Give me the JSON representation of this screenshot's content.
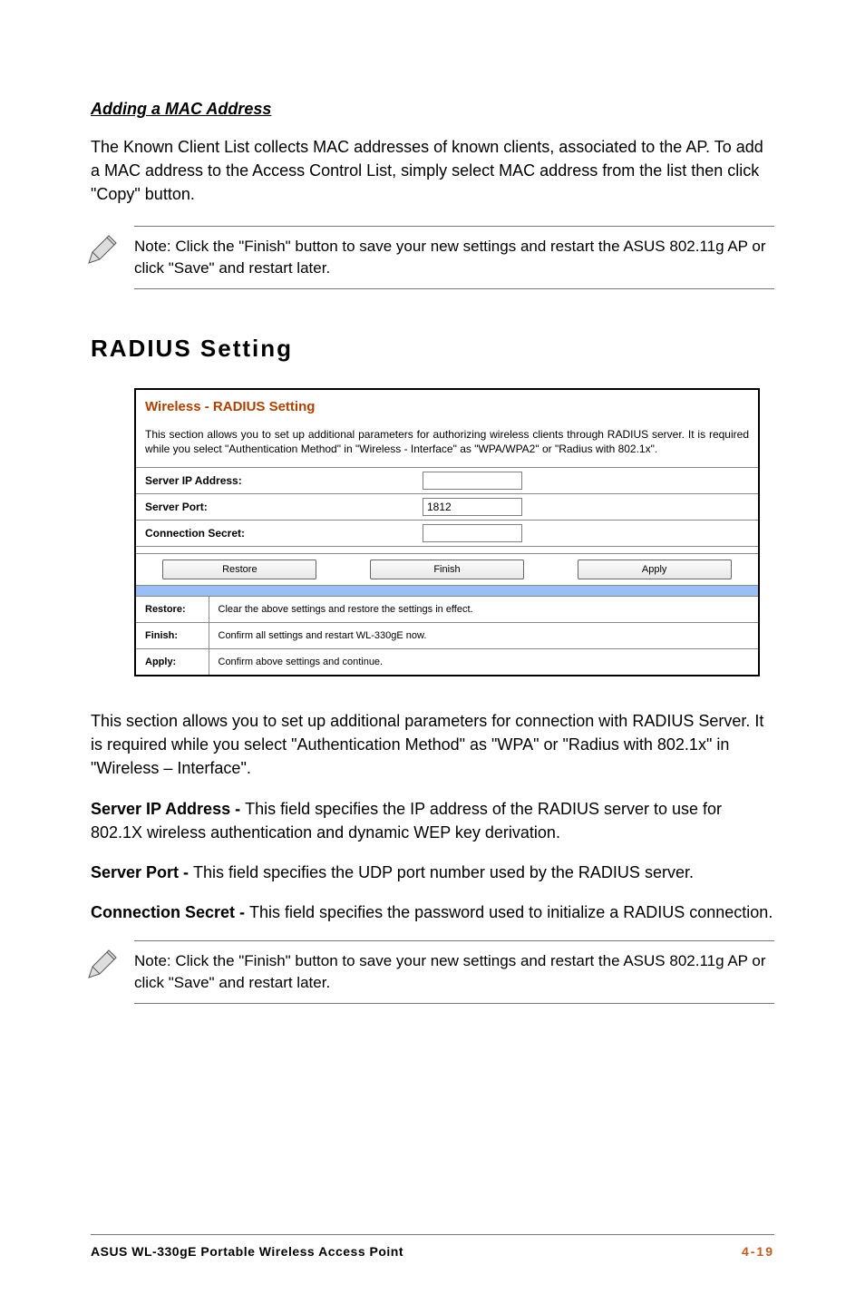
{
  "section1": {
    "heading": "Adding a MAC Address",
    "body": "The Known Client List collects MAC addresses of known clients, associated to the AP. To add a MAC address to the Access Control List, simply select MAC address from the list then click \"Copy\" button.",
    "note": "Note: Click the \"Finish\" button to save your new settings and restart the ASUS 802.11g AP or click \"Save\" and restart later."
  },
  "section2": {
    "heading": "RADIUS Setting",
    "panel": {
      "title": "Wireless - RADIUS Setting",
      "description": "This section allows you to set up additional parameters for authorizing wireless clients through RADIUS server. It is required while you select \"Authentication Method\" in \"Wireless - Interface\" as \"WPA/WPA2\" or \"Radius with 802.1x\".",
      "fields": {
        "server_ip_label": "Server IP Address:",
        "server_ip_value": "",
        "server_port_label": "Server Port:",
        "server_port_value": "1812",
        "conn_secret_label": "Connection Secret:",
        "conn_secret_value": ""
      },
      "buttons": {
        "restore": "Restore",
        "finish": "Finish",
        "apply": "Apply"
      },
      "desc_rows": [
        {
          "label": "Restore:",
          "text": "Clear the above settings and restore the settings in effect."
        },
        {
          "label": "Finish:",
          "text": "Confirm all settings and restart WL-330gE now."
        },
        {
          "label": "Apply:",
          "text": "Confirm above settings and continue."
        }
      ]
    },
    "paragraphs": {
      "p1": "This section allows you to set up additional parameters for connection with RADIUS Server. It is required while you select \"Authentication Method\" as \"WPA\" or \"Radius with 802.1x\" in \"Wireless – Interface\".",
      "p2_lead": "Server IP Address - ",
      "p2_rest": "This field specifies the IP address of the RADIUS server to use for 802.1X wireless authentication and dynamic WEP key derivation.",
      "p3_lead": "Server Port - ",
      "p3_rest": "This field specifies the UDP port number used by the RADIUS server.",
      "p4_lead": "Connection Secret - ",
      "p4_rest": "This field specifies the password used to initialize a RADIUS connection."
    },
    "note": "Note: Click the \"Finish\" button to save your new settings and restart the ASUS 802.11g AP or click \"Save\" and restart later."
  },
  "footer": {
    "left": "ASUS WL-330gE Portable Wireless Access Point",
    "right": "4-19"
  }
}
